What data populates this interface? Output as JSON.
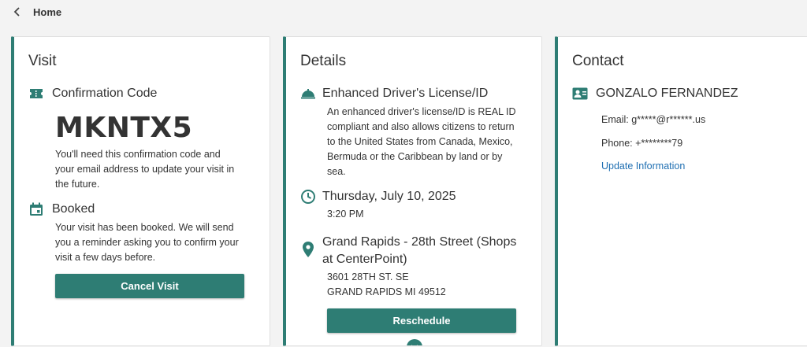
{
  "nav": {
    "back_label": "Home"
  },
  "visit": {
    "title": "Visit",
    "confirmation_label": "Confirmation Code",
    "code": "MKNTX5",
    "code_note_1": "You'll need this confirmation code and",
    "code_note_2": "your email address to update your visit in",
    "code_note_3": "the future.",
    "status_label": "Booked",
    "status_note_1": "Your visit has been booked. We will send",
    "status_note_2": "you a reminder asking you to confirm your",
    "status_note_3": "visit a few days before.",
    "cancel_label": "Cancel Visit"
  },
  "details": {
    "title": "Details",
    "service_label": "Enhanced Driver's License/ID",
    "service_desc_1": "An enhanced driver's license/ID is REAL ID",
    "service_desc_2": "compliant and also allows citizens to return",
    "service_desc_3": "to the United States from Canada, Mexico,",
    "service_desc_4": "Bermuda or the Caribbean by land or by",
    "service_desc_5": "sea.",
    "date_label": "Thursday, July 10, 2025",
    "time": "3:20 PM",
    "location_line1": "Grand Rapids - 28th Street (Shops",
    "location_line2": "at CenterPoint)",
    "address_1": "3601 28TH ST. SE",
    "address_2": "GRAND RAPIDS MI 49512",
    "reschedule_label": "Reschedule"
  },
  "contact": {
    "title": "Contact",
    "name": "GONZALO FERNANDEZ",
    "email": "Email: g*****@r******.us",
    "phone": "Phone: +********79",
    "update_label": "Update Information"
  },
  "colors": {
    "accent": "#2e7d74",
    "link": "#1f6fb2"
  }
}
